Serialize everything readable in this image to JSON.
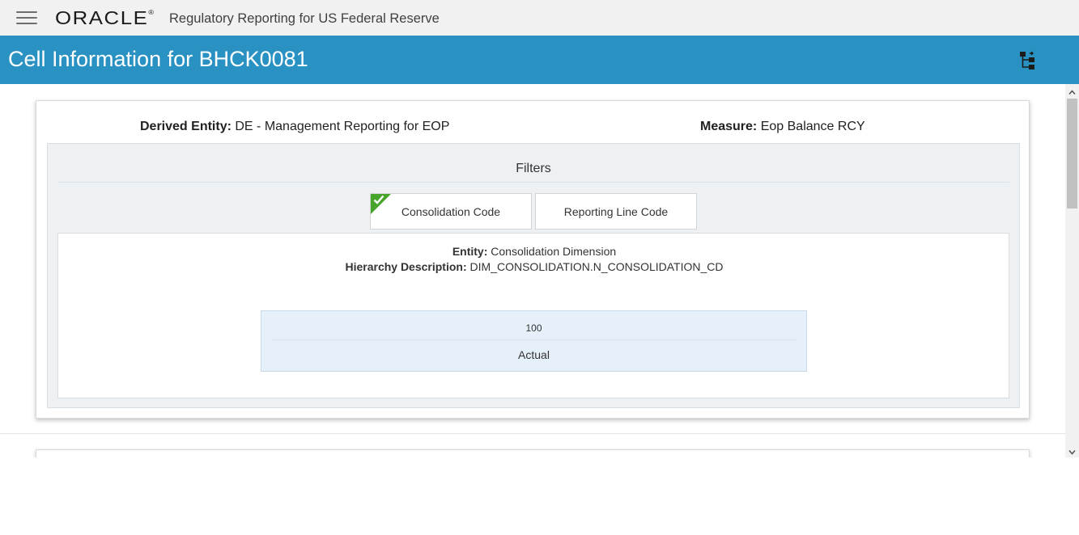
{
  "header": {
    "logo_text": "ORACLE",
    "logo_mark": "®",
    "app_name": "Regulatory Reporting for US Federal Reserve",
    "menu_icon": "hamburger-menu-icon"
  },
  "title_bar": {
    "title": "Cell Information for BHCK0081",
    "action_icon": "data-flow-icon"
  },
  "cell_info": {
    "derived_entity_label": "Derived Entity:",
    "derived_entity_value": "DE - Management Reporting for EOP",
    "measure_label": "Measure:",
    "measure_value": "Eop Balance RCY"
  },
  "filters": {
    "title": "Filters",
    "tabs": [
      {
        "label": "Consolidation Code",
        "selected": true
      },
      {
        "label": "Reporting Line Code",
        "selected": false
      }
    ],
    "selected_tab_indicator_color": "#47a52c"
  },
  "filter_detail": {
    "entity_label": "Entity:",
    "entity_value": "Consolidation Dimension",
    "hierarchy_label": "Hierarchy Description:",
    "hierarchy_value": "DIM_CONSOLIDATION.N_CONSOLIDATION_CD",
    "values": [
      {
        "code": "100",
        "label": "Actual"
      }
    ]
  },
  "colors": {
    "title_bar": "#2a92c3",
    "top_bar": "#f1f1f1",
    "value_box": "#e6f0fa"
  }
}
